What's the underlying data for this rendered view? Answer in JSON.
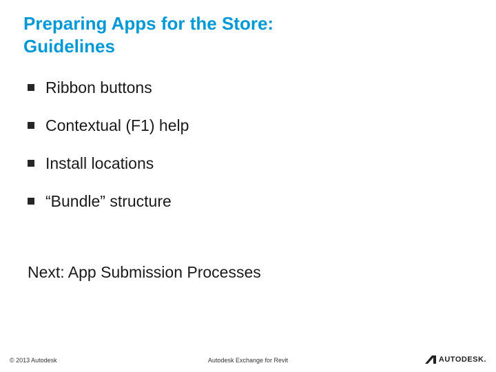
{
  "title": "Preparing Apps for the Store:\nGuidelines",
  "bullets": [
    "Ribbon buttons",
    "Contextual (F1) help",
    "Install locations",
    "“Bundle” structure"
  ],
  "next": "Next: App Submission Processes",
  "footer": {
    "copyright": "© 2013 Autodesk",
    "center": "Autodesk Exchange for Revit",
    "brand": "AUTODESK."
  }
}
